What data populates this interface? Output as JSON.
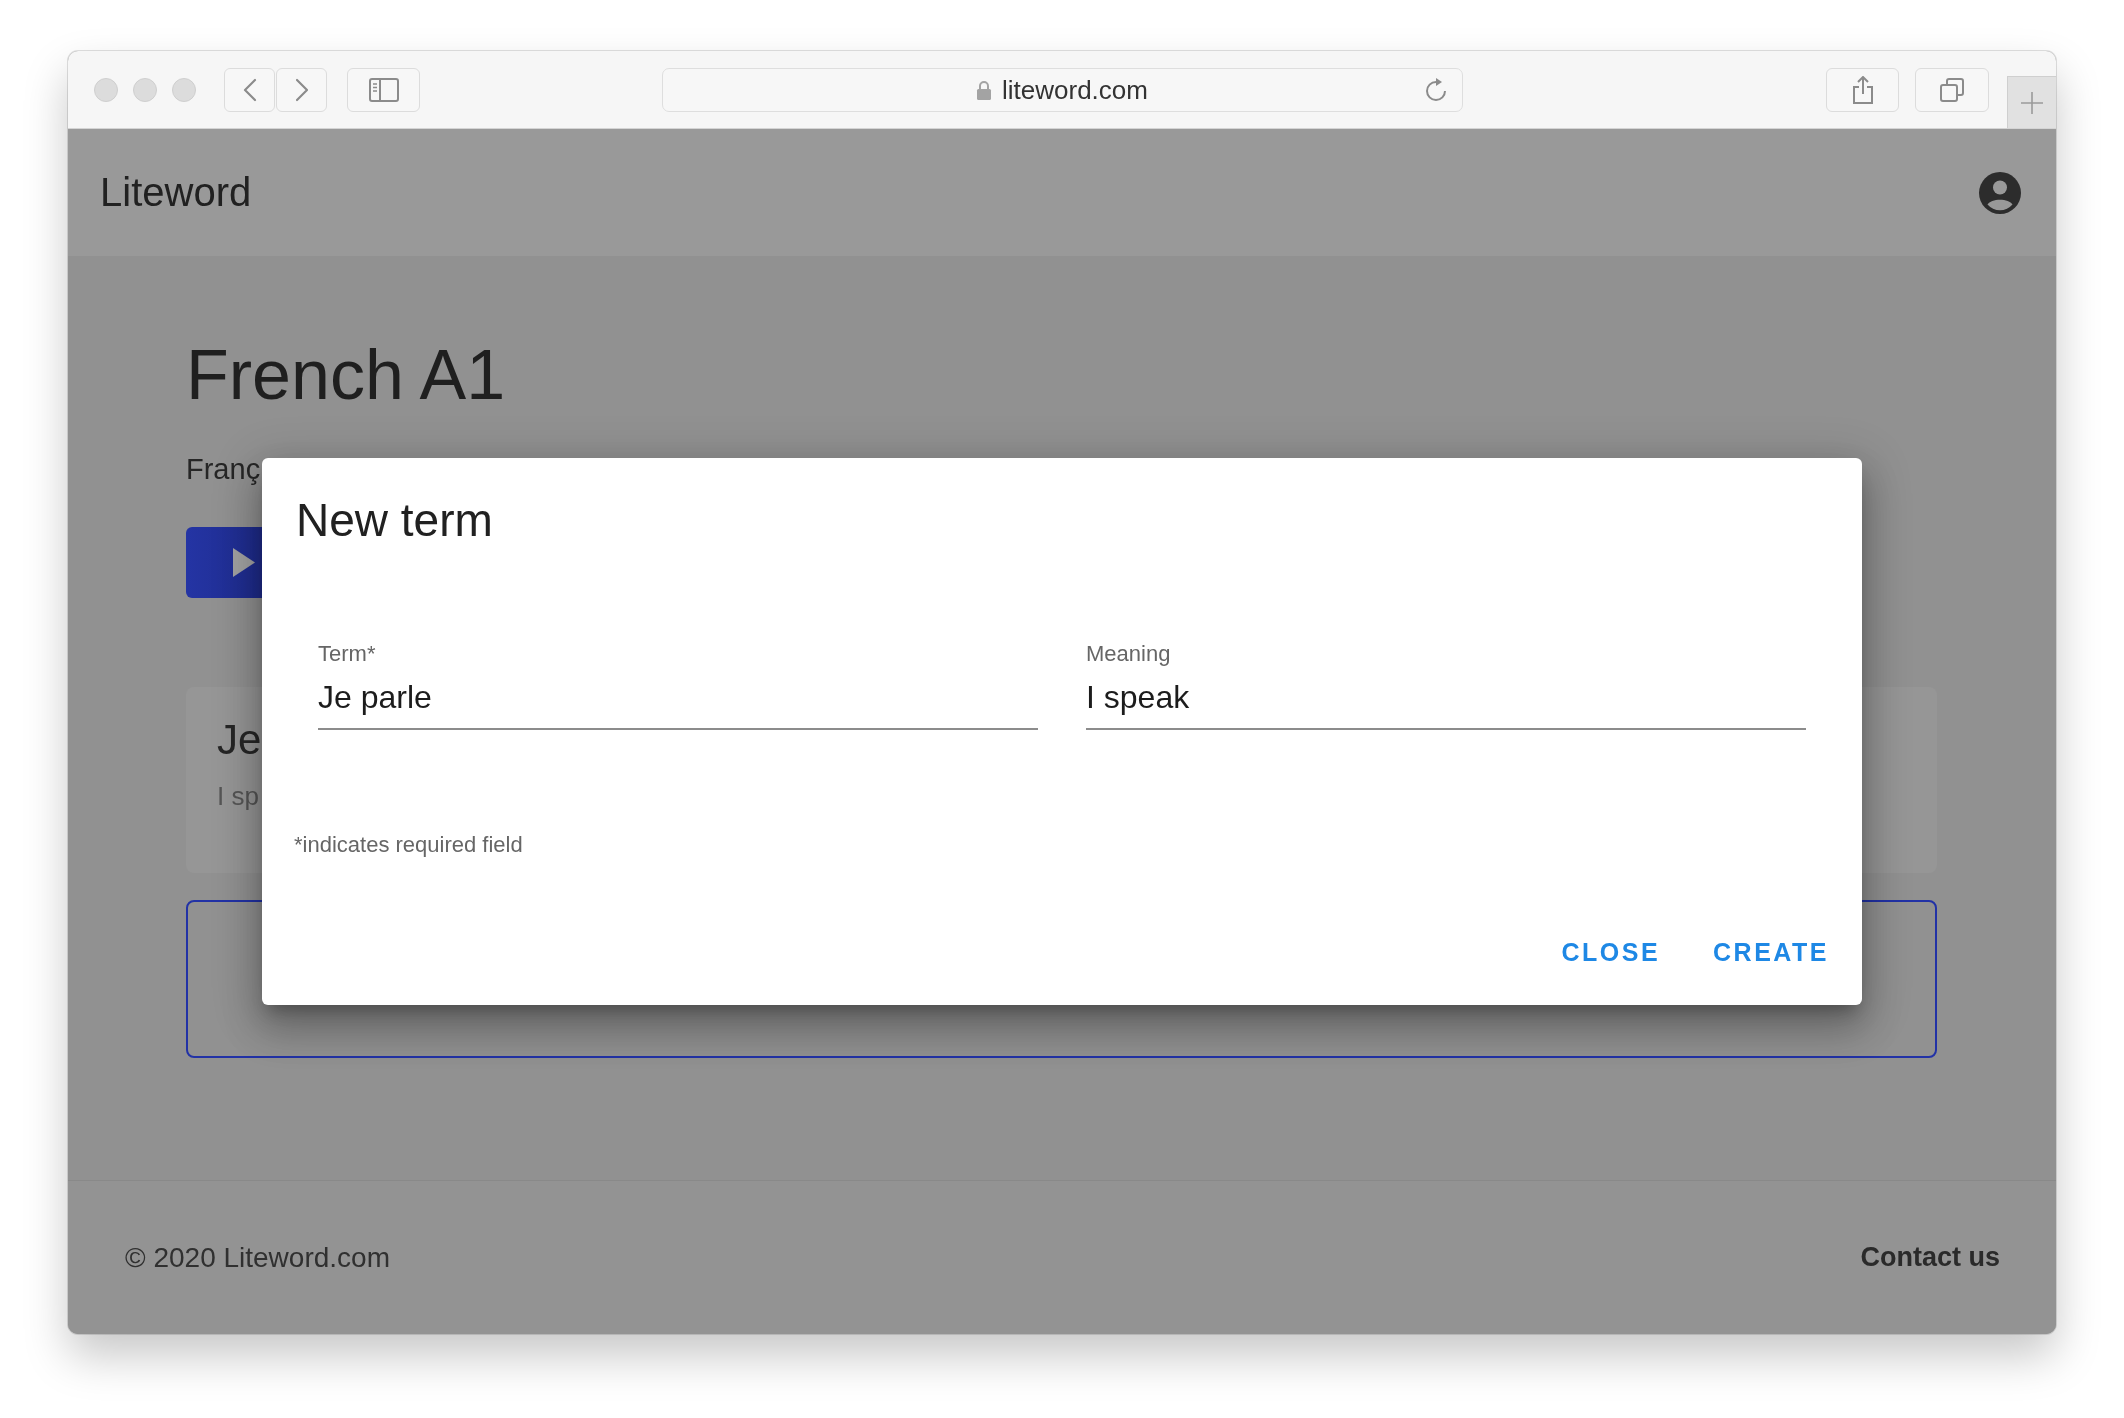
{
  "browser": {
    "url": "liteword.com"
  },
  "header": {
    "brand": "Liteword"
  },
  "page": {
    "title": "French A1",
    "subtitle": "Franç",
    "term_card": {
      "term": "Je",
      "meaning": "I sp"
    }
  },
  "dialog": {
    "title": "New term",
    "fields": [
      {
        "label": "Term*",
        "value": "Je parle"
      },
      {
        "label": "Meaning",
        "value": "I speak"
      }
    ],
    "note": "*indicates required field",
    "buttons": [
      "CLOSE",
      "CREATE"
    ]
  },
  "footer": {
    "copyright": "© 2020 Liteword.com",
    "link": "Contact us"
  }
}
